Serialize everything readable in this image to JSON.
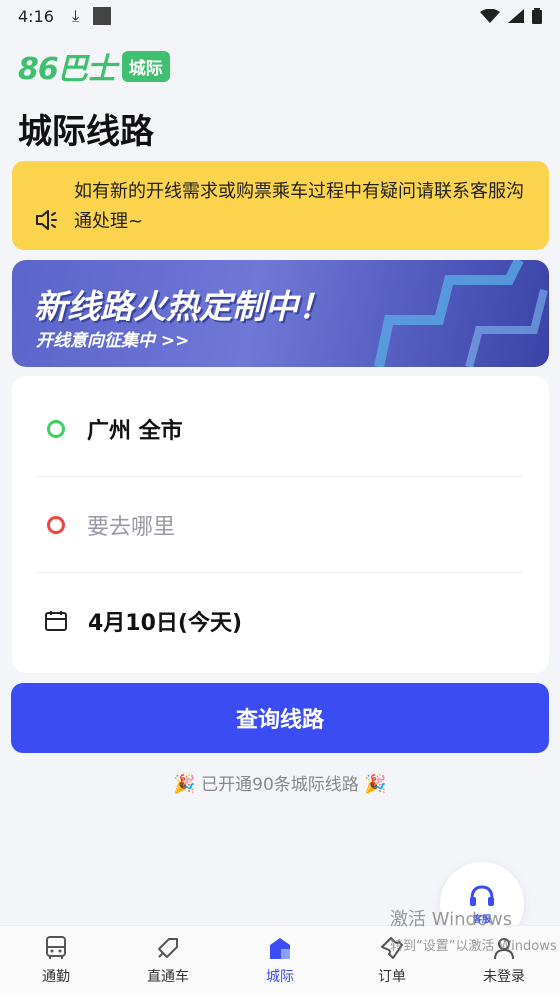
{
  "status_bar": {
    "time": "4:16"
  },
  "brand": {
    "logo": "86巴士",
    "tag": "城际"
  },
  "page": {
    "title": "城际线路"
  },
  "notice": {
    "icon": "speaker-icon",
    "text": "如有新的开线需求或购票乘车过程中有疑问请联系客服沟通处理~"
  },
  "banner": {
    "title": "新线路火热定制中！",
    "subtitle": "开线意向征集中 >>"
  },
  "form": {
    "origin": "广州 全市",
    "destination_placeholder": "要去哪里",
    "date": "4月10日(今天)"
  },
  "search_button": {
    "label": "查询线路"
  },
  "opened_lines": {
    "text": "已开通90条城际线路",
    "emoji": "🎉"
  },
  "customer_service": {
    "label": "客服"
  },
  "watermark": {
    "line1": "激活 Windows",
    "line2": "转到“设置”以激活 Windows"
  },
  "tabs": [
    {
      "label": "通勤",
      "icon": "bus-icon",
      "active": false
    },
    {
      "label": "直通车",
      "icon": "direct-icon",
      "active": false
    },
    {
      "label": "城际",
      "icon": "intercity-icon",
      "active": true
    },
    {
      "label": "订单",
      "icon": "ticket-icon",
      "active": false
    },
    {
      "label": "未登录",
      "icon": "user-icon",
      "active": false
    }
  ],
  "colors": {
    "accent": "#3b4cf5",
    "brand_green": "#3fbf6f",
    "notice_bg": "#fcd34d"
  }
}
